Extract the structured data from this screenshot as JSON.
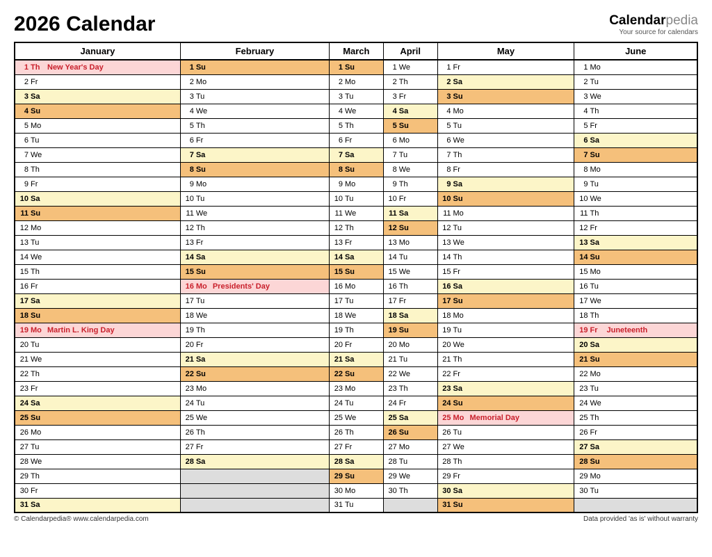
{
  "title": "2026 Calendar",
  "brand": {
    "name1": "Calendar",
    "name2": "pedia",
    "tag": "Your source for calendars"
  },
  "footer": {
    "left": "© Calendarpedia®   www.calendarpedia.com",
    "right": "Data provided 'as is' without warranty"
  },
  "months": [
    "January",
    "February",
    "March",
    "April",
    "May",
    "June"
  ],
  "days": [
    [
      {
        "n": 1,
        "w": "Th",
        "t": "hol",
        "h": "New Year's Day"
      },
      {
        "n": 2,
        "w": "Fr"
      },
      {
        "n": 3,
        "w": "Sa",
        "t": "sat"
      },
      {
        "n": 4,
        "w": "Su",
        "t": "sun"
      },
      {
        "n": 5,
        "w": "Mo"
      },
      {
        "n": 6,
        "w": "Tu"
      },
      {
        "n": 7,
        "w": "We"
      },
      {
        "n": 8,
        "w": "Th"
      },
      {
        "n": 9,
        "w": "Fr"
      },
      {
        "n": 10,
        "w": "Sa",
        "t": "sat"
      },
      {
        "n": 11,
        "w": "Su",
        "t": "sun"
      },
      {
        "n": 12,
        "w": "Mo"
      },
      {
        "n": 13,
        "w": "Tu"
      },
      {
        "n": 14,
        "w": "We"
      },
      {
        "n": 15,
        "w": "Th"
      },
      {
        "n": 16,
        "w": "Fr"
      },
      {
        "n": 17,
        "w": "Sa",
        "t": "sat"
      },
      {
        "n": 18,
        "w": "Su",
        "t": "sun"
      },
      {
        "n": 19,
        "w": "Mo",
        "t": "hol",
        "h": "Martin L. King Day"
      },
      {
        "n": 20,
        "w": "Tu"
      },
      {
        "n": 21,
        "w": "We"
      },
      {
        "n": 22,
        "w": "Th"
      },
      {
        "n": 23,
        "w": "Fr"
      },
      {
        "n": 24,
        "w": "Sa",
        "t": "sat"
      },
      {
        "n": 25,
        "w": "Su",
        "t": "sun"
      },
      {
        "n": 26,
        "w": "Mo"
      },
      {
        "n": 27,
        "w": "Tu"
      },
      {
        "n": 28,
        "w": "We"
      },
      {
        "n": 29,
        "w": "Th"
      },
      {
        "n": 30,
        "w": "Fr"
      },
      {
        "n": 31,
        "w": "Sa",
        "t": "sat"
      }
    ],
    [
      {
        "n": 1,
        "w": "Su",
        "t": "sun"
      },
      {
        "n": 2,
        "w": "Mo"
      },
      {
        "n": 3,
        "w": "Tu"
      },
      {
        "n": 4,
        "w": "We"
      },
      {
        "n": 5,
        "w": "Th"
      },
      {
        "n": 6,
        "w": "Fr"
      },
      {
        "n": 7,
        "w": "Sa",
        "t": "sat"
      },
      {
        "n": 8,
        "w": "Su",
        "t": "sun"
      },
      {
        "n": 9,
        "w": "Mo"
      },
      {
        "n": 10,
        "w": "Tu"
      },
      {
        "n": 11,
        "w": "We"
      },
      {
        "n": 12,
        "w": "Th"
      },
      {
        "n": 13,
        "w": "Fr"
      },
      {
        "n": 14,
        "w": "Sa",
        "t": "sat"
      },
      {
        "n": 15,
        "w": "Su",
        "t": "sun"
      },
      {
        "n": 16,
        "w": "Mo",
        "t": "hol",
        "h": "Presidents' Day"
      },
      {
        "n": 17,
        "w": "Tu"
      },
      {
        "n": 18,
        "w": "We"
      },
      {
        "n": 19,
        "w": "Th"
      },
      {
        "n": 20,
        "w": "Fr"
      },
      {
        "n": 21,
        "w": "Sa",
        "t": "sat"
      },
      {
        "n": 22,
        "w": "Su",
        "t": "sun"
      },
      {
        "n": 23,
        "w": "Mo"
      },
      {
        "n": 24,
        "w": "Tu"
      },
      {
        "n": 25,
        "w": "We"
      },
      {
        "n": 26,
        "w": "Th"
      },
      {
        "n": 27,
        "w": "Fr"
      },
      {
        "n": 28,
        "w": "Sa",
        "t": "sat"
      },
      {
        "t": "empty"
      },
      {
        "t": "empty"
      },
      {
        "t": "empty"
      }
    ],
    [
      {
        "n": 1,
        "w": "Su",
        "t": "sun"
      },
      {
        "n": 2,
        "w": "Mo"
      },
      {
        "n": 3,
        "w": "Tu"
      },
      {
        "n": 4,
        "w": "We"
      },
      {
        "n": 5,
        "w": "Th"
      },
      {
        "n": 6,
        "w": "Fr"
      },
      {
        "n": 7,
        "w": "Sa",
        "t": "sat"
      },
      {
        "n": 8,
        "w": "Su",
        "t": "sun"
      },
      {
        "n": 9,
        "w": "Mo"
      },
      {
        "n": 10,
        "w": "Tu"
      },
      {
        "n": 11,
        "w": "We"
      },
      {
        "n": 12,
        "w": "Th"
      },
      {
        "n": 13,
        "w": "Fr"
      },
      {
        "n": 14,
        "w": "Sa",
        "t": "sat"
      },
      {
        "n": 15,
        "w": "Su",
        "t": "sun"
      },
      {
        "n": 16,
        "w": "Mo"
      },
      {
        "n": 17,
        "w": "Tu"
      },
      {
        "n": 18,
        "w": "We"
      },
      {
        "n": 19,
        "w": "Th"
      },
      {
        "n": 20,
        "w": "Fr"
      },
      {
        "n": 21,
        "w": "Sa",
        "t": "sat"
      },
      {
        "n": 22,
        "w": "Su",
        "t": "sun"
      },
      {
        "n": 23,
        "w": "Mo"
      },
      {
        "n": 24,
        "w": "Tu"
      },
      {
        "n": 25,
        "w": "We"
      },
      {
        "n": 26,
        "w": "Th"
      },
      {
        "n": 27,
        "w": "Fr"
      },
      {
        "n": 28,
        "w": "Sa",
        "t": "sat"
      },
      {
        "n": 29,
        "w": "Su",
        "t": "sun"
      },
      {
        "n": 30,
        "w": "Mo"
      },
      {
        "n": 31,
        "w": "Tu"
      }
    ],
    [
      {
        "n": 1,
        "w": "We"
      },
      {
        "n": 2,
        "w": "Th"
      },
      {
        "n": 3,
        "w": "Fr"
      },
      {
        "n": 4,
        "w": "Sa",
        "t": "sat"
      },
      {
        "n": 5,
        "w": "Su",
        "t": "sun"
      },
      {
        "n": 6,
        "w": "Mo"
      },
      {
        "n": 7,
        "w": "Tu"
      },
      {
        "n": 8,
        "w": "We"
      },
      {
        "n": 9,
        "w": "Th"
      },
      {
        "n": 10,
        "w": "Fr"
      },
      {
        "n": 11,
        "w": "Sa",
        "t": "sat"
      },
      {
        "n": 12,
        "w": "Su",
        "t": "sun"
      },
      {
        "n": 13,
        "w": "Mo"
      },
      {
        "n": 14,
        "w": "Tu"
      },
      {
        "n": 15,
        "w": "We"
      },
      {
        "n": 16,
        "w": "Th"
      },
      {
        "n": 17,
        "w": "Fr"
      },
      {
        "n": 18,
        "w": "Sa",
        "t": "sat"
      },
      {
        "n": 19,
        "w": "Su",
        "t": "sun"
      },
      {
        "n": 20,
        "w": "Mo"
      },
      {
        "n": 21,
        "w": "Tu"
      },
      {
        "n": 22,
        "w": "We"
      },
      {
        "n": 23,
        "w": "Th"
      },
      {
        "n": 24,
        "w": "Fr"
      },
      {
        "n": 25,
        "w": "Sa",
        "t": "sat"
      },
      {
        "n": 26,
        "w": "Su",
        "t": "sun"
      },
      {
        "n": 27,
        "w": "Mo"
      },
      {
        "n": 28,
        "w": "Tu"
      },
      {
        "n": 29,
        "w": "We"
      },
      {
        "n": 30,
        "w": "Th"
      },
      {
        "t": "empty"
      }
    ],
    [
      {
        "n": 1,
        "w": "Fr"
      },
      {
        "n": 2,
        "w": "Sa",
        "t": "sat"
      },
      {
        "n": 3,
        "w": "Su",
        "t": "sun"
      },
      {
        "n": 4,
        "w": "Mo"
      },
      {
        "n": 5,
        "w": "Tu"
      },
      {
        "n": 6,
        "w": "We"
      },
      {
        "n": 7,
        "w": "Th"
      },
      {
        "n": 8,
        "w": "Fr"
      },
      {
        "n": 9,
        "w": "Sa",
        "t": "sat"
      },
      {
        "n": 10,
        "w": "Su",
        "t": "sun"
      },
      {
        "n": 11,
        "w": "Mo"
      },
      {
        "n": 12,
        "w": "Tu"
      },
      {
        "n": 13,
        "w": "We"
      },
      {
        "n": 14,
        "w": "Th"
      },
      {
        "n": 15,
        "w": "Fr"
      },
      {
        "n": 16,
        "w": "Sa",
        "t": "sat"
      },
      {
        "n": 17,
        "w": "Su",
        "t": "sun"
      },
      {
        "n": 18,
        "w": "Mo"
      },
      {
        "n": 19,
        "w": "Tu"
      },
      {
        "n": 20,
        "w": "We"
      },
      {
        "n": 21,
        "w": "Th"
      },
      {
        "n": 22,
        "w": "Fr"
      },
      {
        "n": 23,
        "w": "Sa",
        "t": "sat"
      },
      {
        "n": 24,
        "w": "Su",
        "t": "sun"
      },
      {
        "n": 25,
        "w": "Mo",
        "t": "hol",
        "h": "Memorial Day"
      },
      {
        "n": 26,
        "w": "Tu"
      },
      {
        "n": 27,
        "w": "We"
      },
      {
        "n": 28,
        "w": "Th"
      },
      {
        "n": 29,
        "w": "Fr"
      },
      {
        "n": 30,
        "w": "Sa",
        "t": "sat"
      },
      {
        "n": 31,
        "w": "Su",
        "t": "sun"
      }
    ],
    [
      {
        "n": 1,
        "w": "Mo"
      },
      {
        "n": 2,
        "w": "Tu"
      },
      {
        "n": 3,
        "w": "We"
      },
      {
        "n": 4,
        "w": "Th"
      },
      {
        "n": 5,
        "w": "Fr"
      },
      {
        "n": 6,
        "w": "Sa",
        "t": "sat"
      },
      {
        "n": 7,
        "w": "Su",
        "t": "sun"
      },
      {
        "n": 8,
        "w": "Mo"
      },
      {
        "n": 9,
        "w": "Tu"
      },
      {
        "n": 10,
        "w": "We"
      },
      {
        "n": 11,
        "w": "Th"
      },
      {
        "n": 12,
        "w": "Fr"
      },
      {
        "n": 13,
        "w": "Sa",
        "t": "sat"
      },
      {
        "n": 14,
        "w": "Su",
        "t": "sun"
      },
      {
        "n": 15,
        "w": "Mo"
      },
      {
        "n": 16,
        "w": "Tu"
      },
      {
        "n": 17,
        "w": "We"
      },
      {
        "n": 18,
        "w": "Th"
      },
      {
        "n": 19,
        "w": "Fr",
        "t": "hol",
        "h": "Juneteenth"
      },
      {
        "n": 20,
        "w": "Sa",
        "t": "sat"
      },
      {
        "n": 21,
        "w": "Su",
        "t": "sun"
      },
      {
        "n": 22,
        "w": "Mo"
      },
      {
        "n": 23,
        "w": "Tu"
      },
      {
        "n": 24,
        "w": "We"
      },
      {
        "n": 25,
        "w": "Th"
      },
      {
        "n": 26,
        "w": "Fr"
      },
      {
        "n": 27,
        "w": "Sa",
        "t": "sat"
      },
      {
        "n": 28,
        "w": "Su",
        "t": "sun"
      },
      {
        "n": 29,
        "w": "Mo"
      },
      {
        "n": 30,
        "w": "Tu"
      },
      {
        "t": "empty"
      }
    ]
  ]
}
